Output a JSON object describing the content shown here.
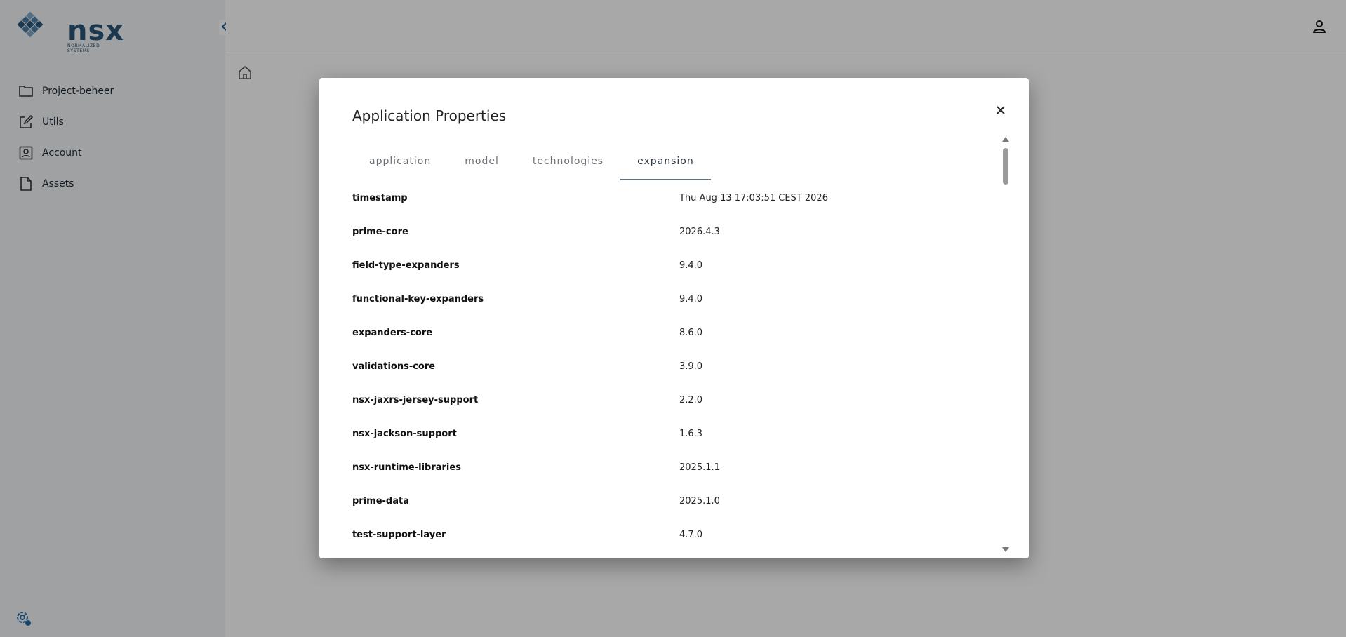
{
  "brand": {
    "name": "nsx",
    "tagline": "NORMALIZED SYSTEMS",
    "color": "#2b5578"
  },
  "sidebar": {
    "items": [
      {
        "label": "Project-beheer",
        "icon": "folder-icon"
      },
      {
        "label": "Utils",
        "icon": "edit-icon"
      },
      {
        "label": "Account",
        "icon": "account-box-icon"
      },
      {
        "label": "Assets",
        "icon": "file-icon"
      }
    ]
  },
  "modal": {
    "title": "Application Properties",
    "tabs": [
      {
        "label": "application",
        "active": false
      },
      {
        "label": "model",
        "active": false
      },
      {
        "label": "technologies",
        "active": false
      },
      {
        "label": "expansion",
        "active": true
      }
    ],
    "rows": [
      {
        "key": "timestamp",
        "value": "Thu Aug 13 17:03:51 CEST 2026"
      },
      {
        "key": "prime-core",
        "value": "2026.4.3"
      },
      {
        "key": "field-type-expanders",
        "value": "9.4.0"
      },
      {
        "key": "functional-key-expanders",
        "value": "9.4.0"
      },
      {
        "key": "expanders-core",
        "value": "8.6.0"
      },
      {
        "key": "validations-core",
        "value": "3.9.0"
      },
      {
        "key": "nsx-jaxrs-jersey-support",
        "value": "2.2.0"
      },
      {
        "key": "nsx-jackson-support",
        "value": "1.6.3"
      },
      {
        "key": "nsx-runtime-libraries",
        "value": "2025.1.1"
      },
      {
        "key": "prime-data",
        "value": "2025.1.0"
      },
      {
        "key": "test-support-layer",
        "value": "4.7.0"
      }
    ]
  }
}
